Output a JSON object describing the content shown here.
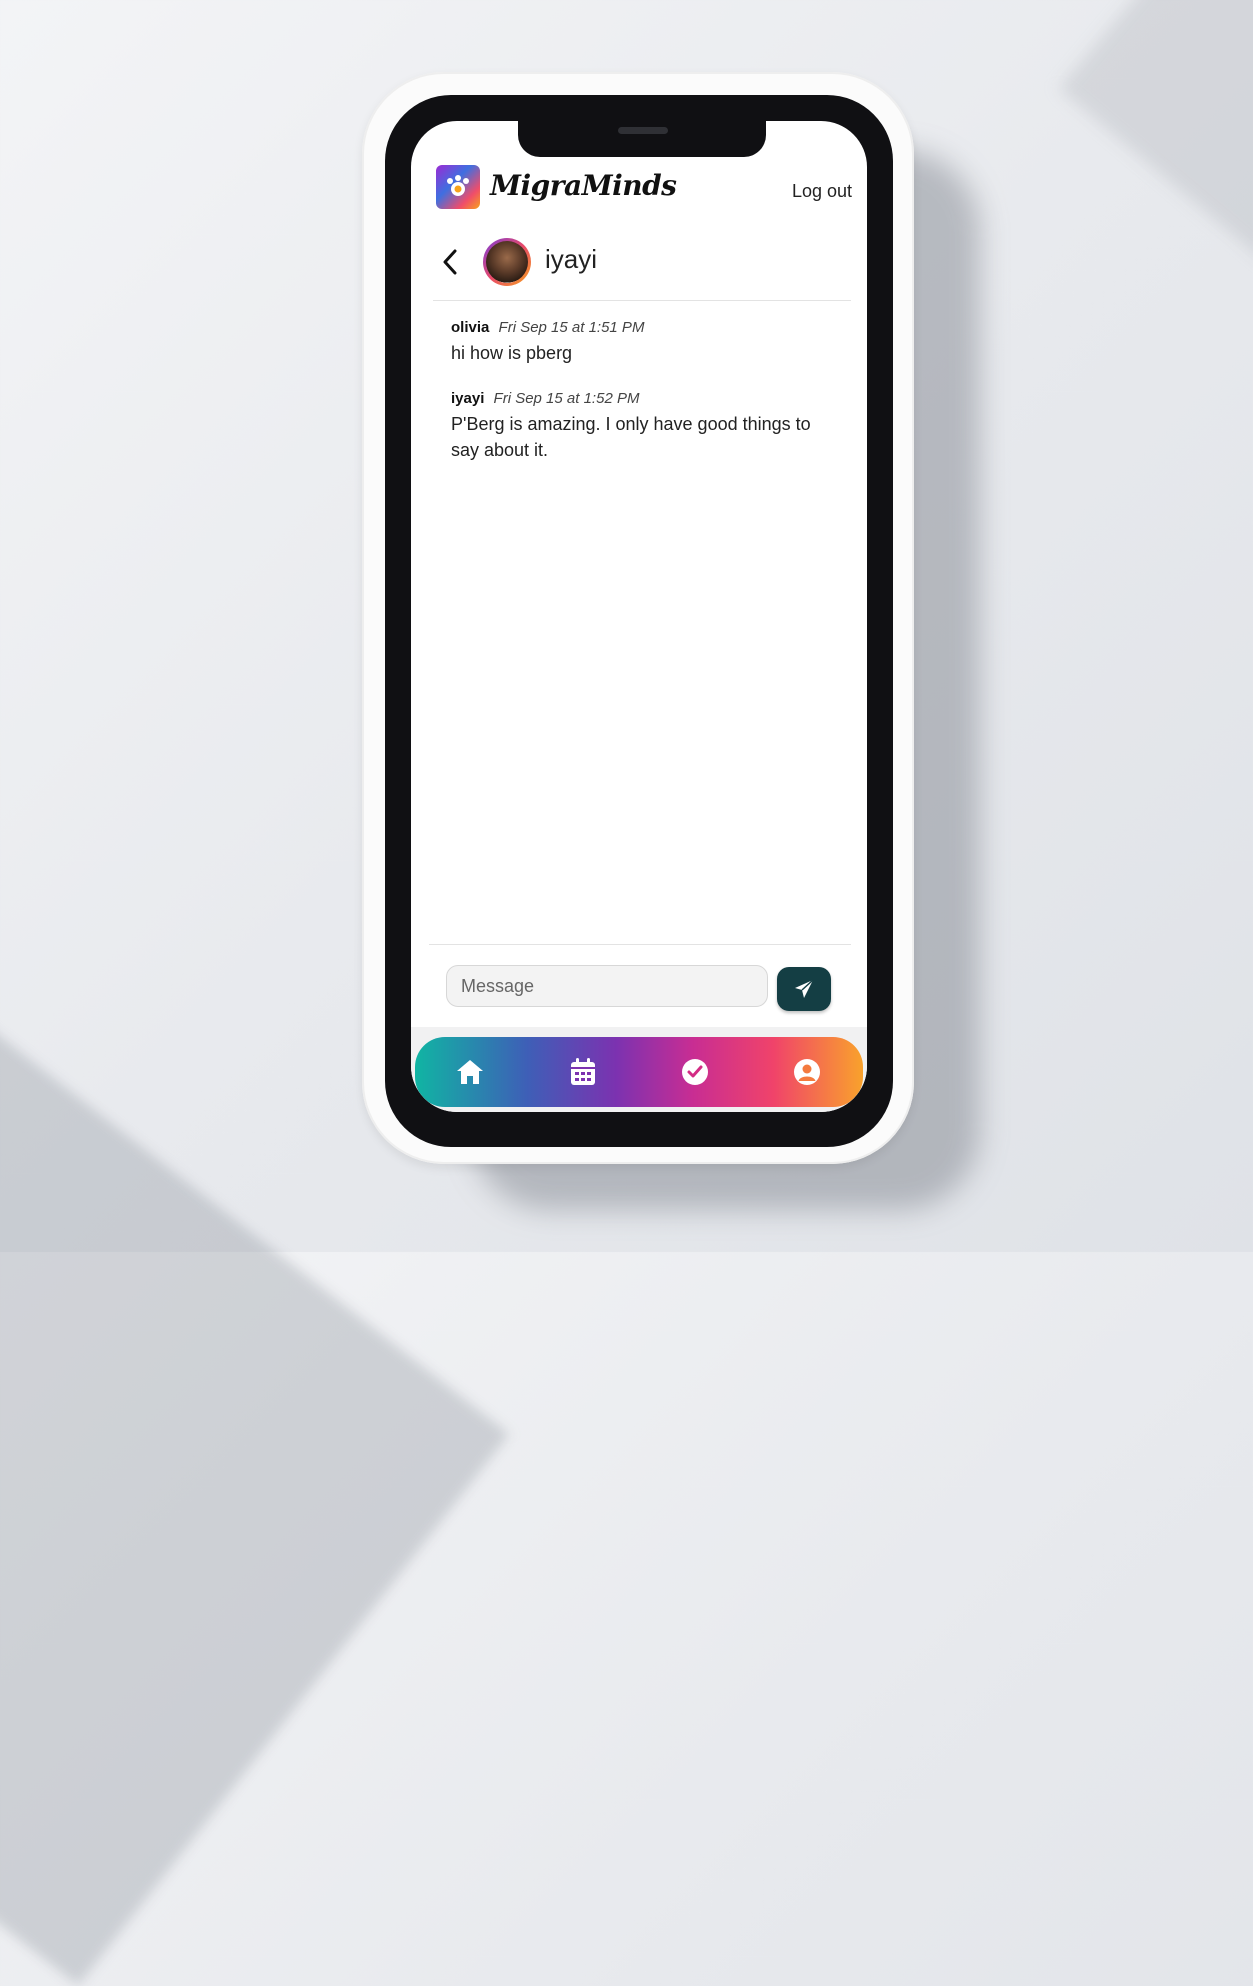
{
  "app": {
    "brand": "MigraMinds",
    "logout_label": "Log out"
  },
  "chat": {
    "contact_name": "iyayi",
    "messages": [
      {
        "author": "olivia",
        "time": "Fri Sep 15 at 1:51 PM",
        "text": "hi how is pberg"
      },
      {
        "author": "iyayi",
        "time": "Fri Sep 15 at 1:52 PM",
        "text": "P'Berg is amazing. I only have good things to say about it."
      }
    ]
  },
  "composer": {
    "placeholder": "Message",
    "send_icon": "paper-plane-icon",
    "send_color": "#143e44"
  },
  "bottom_nav": {
    "items": [
      {
        "icon": "home-icon"
      },
      {
        "icon": "calendar-icon"
      },
      {
        "icon": "check-circle-icon"
      },
      {
        "icon": "user-circle-icon"
      }
    ],
    "gradient": [
      "#10b5a3",
      "#3e5fb7",
      "#7c32b0",
      "#c82d93",
      "#f0436a",
      "#f9a22c"
    ]
  }
}
